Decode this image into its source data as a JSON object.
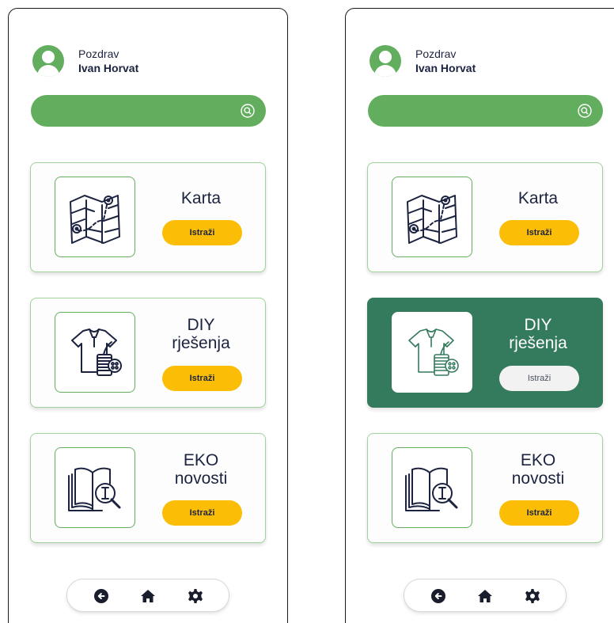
{
  "screens": [
    {
      "greeting": {
        "label": "Pozdrav",
        "name": "Ivan Horvat"
      },
      "search": {
        "placeholder": ""
      },
      "cards": [
        {
          "title": "Karta",
          "button": "Istraži",
          "icon": "map-icon",
          "active": false
        },
        {
          "title": "DIY rješenja",
          "button": "Istraži",
          "icon": "tshirt-sewing-icon",
          "active": false
        },
        {
          "title": "EKO novosti",
          "button": "Istraži",
          "icon": "book-magnifier-icon",
          "active": false
        }
      ],
      "nav": [
        "back-icon",
        "home-icon",
        "settings-icon"
      ]
    },
    {
      "greeting": {
        "label": "Pozdrav",
        "name": "Ivan Horvat"
      },
      "search": {
        "placeholder": ""
      },
      "cards": [
        {
          "title": "Karta",
          "button": "Istraži",
          "icon": "map-icon",
          "active": false
        },
        {
          "title": "DIY rješenja",
          "button": "Istraži",
          "icon": "tshirt-sewing-icon",
          "active": true
        },
        {
          "title": "EKO novosti",
          "button": "Istraži",
          "icon": "book-magnifier-icon",
          "active": false
        }
      ],
      "nav": [
        "back-icon",
        "home-icon",
        "settings-icon"
      ]
    }
  ],
  "colors": {
    "brand_green": "#63ad5f",
    "active_card": "#347a5d",
    "button_yellow": "#fbbd06",
    "text_dark": "#1c2340"
  }
}
